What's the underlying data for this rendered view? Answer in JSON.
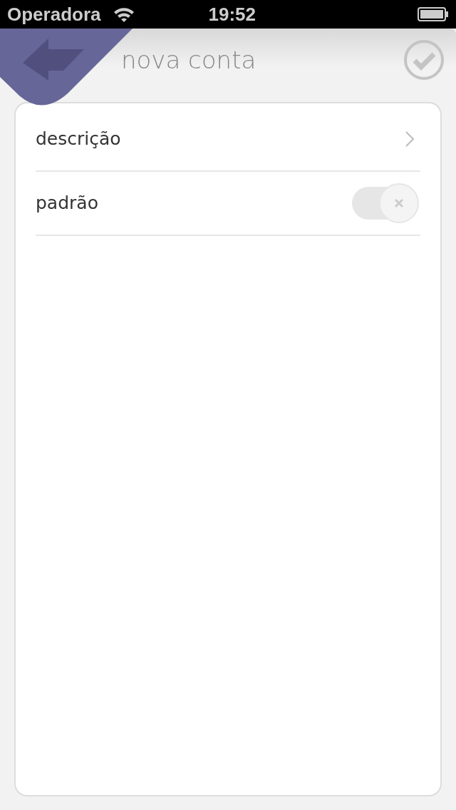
{
  "status_bar": {
    "carrier": "Operadora",
    "time": "19:52"
  },
  "header": {
    "title": "nova conta"
  },
  "rows": [
    {
      "kind": "disclosure",
      "label": "descrição"
    },
    {
      "kind": "toggle",
      "label": "padrão",
      "on": false
    }
  ]
}
